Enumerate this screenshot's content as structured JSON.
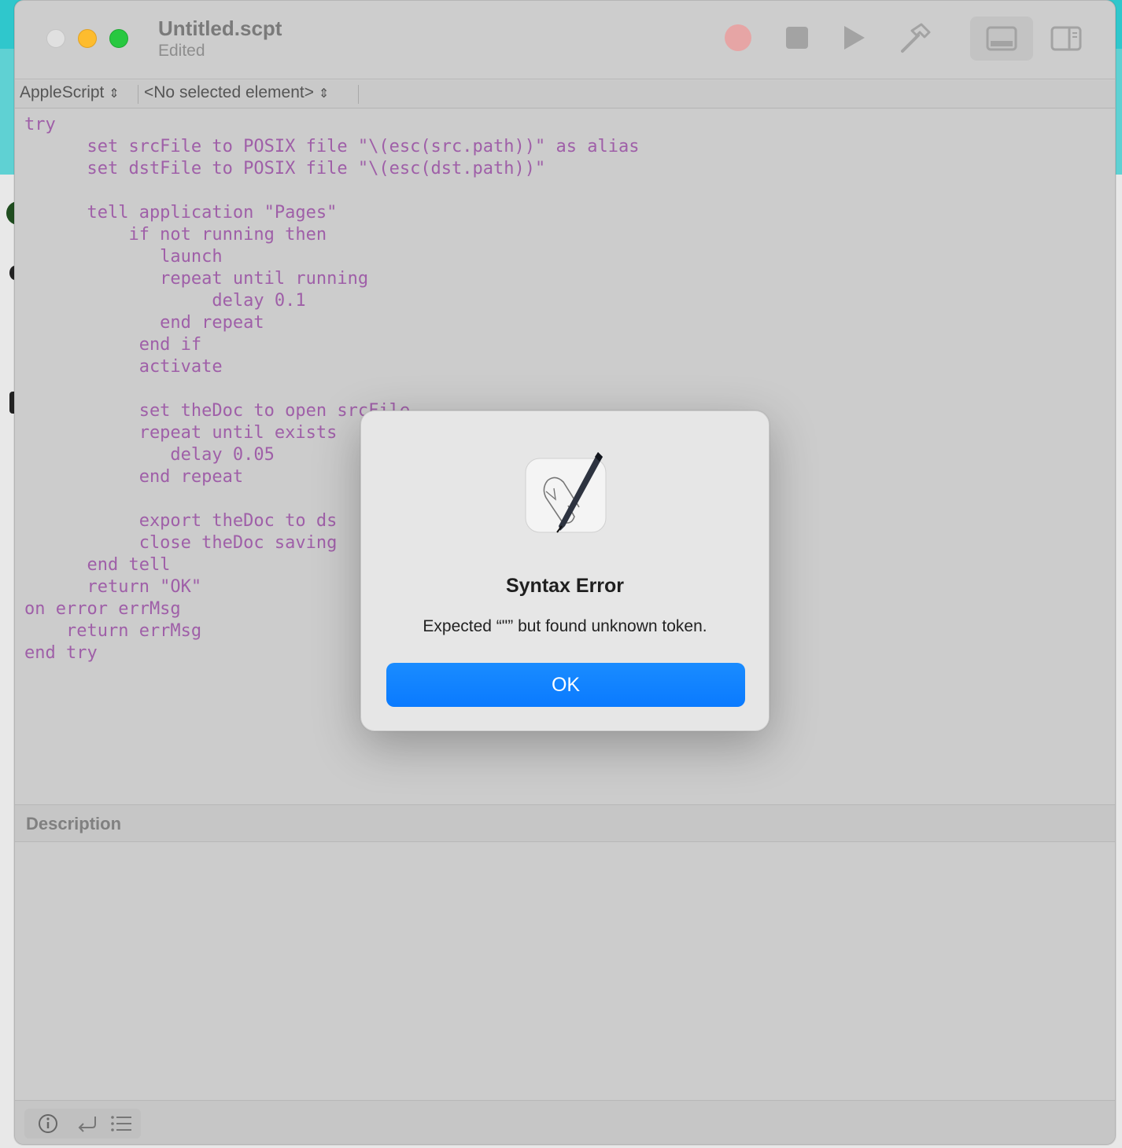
{
  "window": {
    "title": "Untitled.scpt",
    "subtitle": "Edited"
  },
  "toolbar": {
    "icons": [
      "record-icon",
      "stop-icon",
      "run-icon",
      "compile-icon",
      "show-log-icon",
      "show-inspector-icon"
    ]
  },
  "navbar": {
    "language": "AppleScript",
    "element": "<No selected element>"
  },
  "editor": {
    "lines": [
      "try",
      "      set srcFile to POSIX file \"\\(esc(src.path))\" as alias",
      "      set dstFile to POSIX file \"\\(esc(dst.path))\"",
      "",
      "      tell application \"Pages\"",
      "          if not running then",
      "             launch",
      "             repeat until running",
      "                  delay 0.1",
      "             end repeat",
      "           end if",
      "           activate",
      "",
      "           set theDoc to open srcFile",
      "           repeat until exists",
      "              delay 0.05",
      "           end repeat",
      "",
      "           export theDoc to ds",
      "           close theDoc saving",
      "      end tell",
      "      return \"OK\"",
      "on error errMsg",
      "    return errMsg",
      "end try"
    ]
  },
  "description": {
    "title": "Description"
  },
  "dialog": {
    "title": "Syntax Error",
    "message": "Expected “\"” but found unknown token.",
    "ok_label": "OK"
  },
  "colors": {
    "code": "#9f5fa8",
    "accent": "#0a7aff"
  }
}
